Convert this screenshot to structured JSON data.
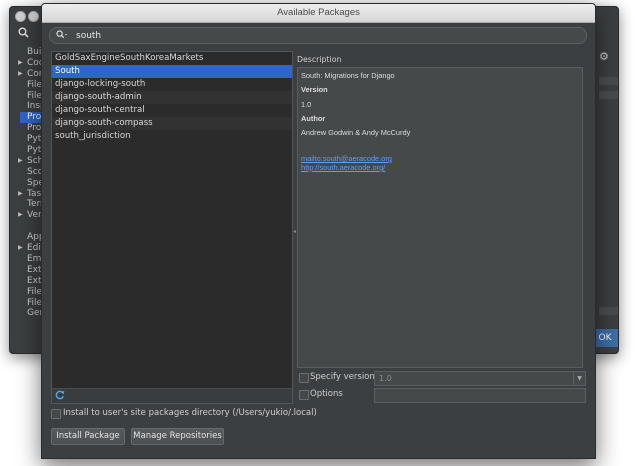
{
  "background_window": {
    "tree": [
      {
        "label": "Buil",
        "arrow": false,
        "selected": false
      },
      {
        "label": "Coc",
        "arrow": true,
        "selected": false
      },
      {
        "label": "Cor",
        "arrow": true,
        "selected": false
      },
      {
        "label": "File",
        "arrow": false,
        "selected": false
      },
      {
        "label": "File",
        "arrow": false,
        "selected": false
      },
      {
        "label": "Insp",
        "arrow": false,
        "selected": false
      },
      {
        "label": "Pro",
        "arrow": false,
        "selected": true
      },
      {
        "label": "Pro",
        "arrow": false,
        "selected": false
      },
      {
        "label": "Pyth",
        "arrow": false,
        "selected": false
      },
      {
        "label": "Pyth",
        "arrow": false,
        "selected": false
      },
      {
        "label": "Sch",
        "arrow": true,
        "selected": false
      },
      {
        "label": "Sco",
        "arrow": false,
        "selected": false
      },
      {
        "label": "Spe",
        "arrow": false,
        "selected": false
      },
      {
        "label": "Tas",
        "arrow": true,
        "selected": false
      },
      {
        "label": "Terr",
        "arrow": false,
        "selected": false
      },
      {
        "label": "Vers",
        "arrow": true,
        "selected": false
      },
      {
        "label": "",
        "gap": true
      },
      {
        "label": "App",
        "arrow": false,
        "selected": false
      },
      {
        "label": "Edit",
        "arrow": true,
        "selected": false
      },
      {
        "label": "Emr",
        "arrow": false,
        "selected": false
      },
      {
        "label": "Exte",
        "arrow": false,
        "selected": false
      },
      {
        "label": "Exte",
        "arrow": false,
        "selected": false
      },
      {
        "label": "File",
        "arrow": false,
        "selected": false
      },
      {
        "label": "File",
        "arrow": false,
        "selected": false
      },
      {
        "label": "Gen",
        "arrow": false,
        "selected": false
      }
    ],
    "ok_label": "OK"
  },
  "dialog": {
    "title": "Available Packages",
    "search": {
      "value": "south",
      "placeholder": ""
    },
    "packages": [
      {
        "label": "GoldSaxEngineSouthKoreaMarkets",
        "selected": false
      },
      {
        "label": "South",
        "selected": true
      },
      {
        "label": "django-locking-south",
        "selected": false
      },
      {
        "label": "django-south-admin",
        "selected": false
      },
      {
        "label": "django-south-central",
        "selected": false
      },
      {
        "label": "django-south-compass",
        "selected": false
      },
      {
        "label": "south_jurisdiction",
        "selected": false
      }
    ],
    "description": {
      "label": "Description",
      "summary": "South: Migrations for Django",
      "version_heading": "Version",
      "version": "1.0",
      "author_heading": "Author",
      "author": "Andrew Godwin & Andy McCurdy",
      "link_mail": "mailto:south@aeracode.org",
      "link_home": "http://south.aeracode.org/"
    },
    "specify_version": {
      "label": "Specify version",
      "value": "1.0",
      "checked": false
    },
    "options": {
      "label": "Options",
      "value": "",
      "checked": false
    },
    "install_site": {
      "label": "Install to user's site packages directory (/Users/yukio/.local)",
      "checked": false
    },
    "buttons": {
      "install": "Install Package",
      "manage": "Manage Repositories"
    }
  },
  "colors": {
    "selection": "#2f65ca",
    "link": "#5d9ff5",
    "panel": "#3c3f41",
    "list": "#2b2b2b"
  }
}
